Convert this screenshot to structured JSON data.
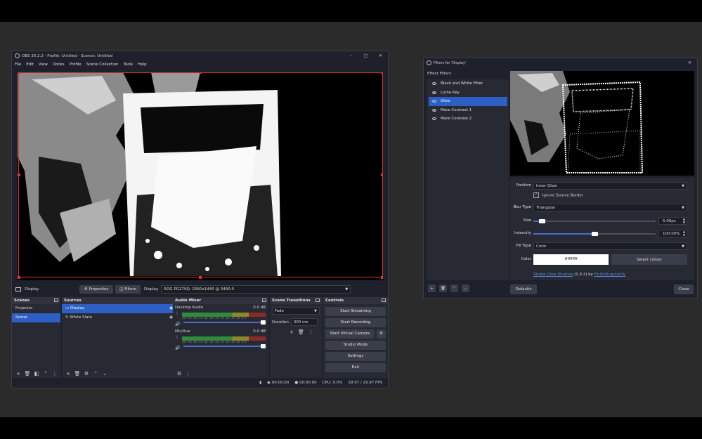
{
  "main": {
    "title": "OBS 30.2.2 - Profile: Untitled - Scenes: Untitled",
    "menu": [
      "File",
      "Edit",
      "View",
      "Docks",
      "Profile",
      "Scene Collection",
      "Tools",
      "Help"
    ],
    "source_bar": {
      "source_name": "Display",
      "properties_label": "Properties",
      "filters_label": "Filters",
      "display_label": "Display",
      "display_value": "ROG PG279Q: 2560x1440 @ 3440,0"
    },
    "scenes": {
      "title": "Scenes",
      "items": [
        "Projector",
        "Scene"
      ],
      "selected": "Scene"
    },
    "sources": {
      "title": "Sources",
      "items": [
        "Display",
        "White Slate"
      ]
    },
    "audio": {
      "title": "Audio Mixer",
      "channels": [
        {
          "name": "Desktop Audio",
          "level": "0.0 dB"
        },
        {
          "name": "Mic/Aux",
          "level": "0.0 dB"
        }
      ],
      "ticks": "-60 -55 -50 -45 -40 -35 -30 -25 -20 -15 -10 -5 0"
    },
    "transitions": {
      "title": "Scene Transitions",
      "type": "Fade",
      "duration_label": "Duration",
      "duration_value": "300 ms"
    },
    "controls": {
      "title": "Controls",
      "buttons": [
        "Start Streaming",
        "Start Recording",
        "Start Virtual Camera",
        "Studio Mode",
        "Settings",
        "Exit"
      ]
    },
    "status": {
      "stream_time": "00:00:00",
      "rec_time": "00:00:00",
      "cpu": "CPU: 0.0%",
      "fps": "29.97 / 29.97 FPS"
    }
  },
  "filters": {
    "title": "Filters for 'Display'",
    "section_label": "Effect Filters",
    "items": [
      "Black and White Filter",
      "Luma Key",
      "Glow",
      "More Contrast 1",
      "More Contrast 2"
    ],
    "selected": "Glow",
    "props": {
      "position_label": "Position",
      "position_value": "Inner Glow",
      "ignore_border_label": "Ignore Source Border",
      "blur_type_label": "Blur Type",
      "blur_type_value": "Triangular",
      "size_label": "Size",
      "size_value": "5.00px",
      "size_fraction": 0.07,
      "intensity_label": "Intensity",
      "intensity_value": "100.00%",
      "intensity_fraction": 0.5,
      "fill_type_label": "Fill Type",
      "fill_type_value": "Color",
      "color_label": "Color",
      "color_value": "#ffffffff",
      "select_colour_label": "Select colour",
      "plugin_name": "Stroke Glow Shadow",
      "plugin_version": "(1.0.2) by",
      "plugin_author": "FiniteSingularity"
    },
    "defaults_label": "Defaults",
    "close_label": "Close"
  },
  "colors": {
    "accent": "#2d5fc5",
    "selection_border": "#e0312c",
    "background": "#1e212b"
  }
}
